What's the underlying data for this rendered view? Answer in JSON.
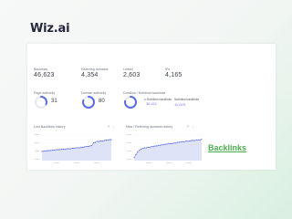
{
  "brand": "Wiz.ai",
  "stats": [
    {
      "label": "Backlinks",
      "value": "46,623"
    },
    {
      "label": "Referring domains",
      "value": "4,354"
    },
    {
      "label": "Linked",
      "value": "2,603"
    },
    {
      "label": "IPs",
      "value": "4,165"
    }
  ],
  "gauges": [
    {
      "label": "Page authority",
      "value": "31",
      "percent": 31
    },
    {
      "label": "Domain authority",
      "value": "80",
      "percent": 80
    },
    {
      "label": "Dofollow / Nofollow backlinks",
      "value": "",
      "percent": 78
    }
  ],
  "link_types": [
    {
      "label": "Dofollow backlinks",
      "value": "36,411"
    },
    {
      "label": "Nofollow backlinks",
      "value": "11,023"
    }
  ],
  "charts": [
    {
      "title": "Lost Backlinks history",
      "icons": "↗ ↓"
    },
    {
      "title": "New / Referring domains history",
      "icons": "↗ ↓"
    }
  ],
  "link_text": "Backlinks",
  "colors": {
    "accent": "#5b6ee1",
    "gauge_track": "#e6e9f2",
    "link": "#4caf50",
    "secondary": "#7b6cf0"
  },
  "chart_data": [
    {
      "type": "area",
      "title": "Lost Backlinks history",
      "y": [
        20,
        21,
        21,
        22,
        22,
        22,
        23,
        23,
        24,
        24,
        24,
        25,
        25,
        25,
        26,
        26,
        26,
        27,
        27,
        28,
        28,
        28,
        29,
        29,
        30,
        31,
        31,
        32,
        33,
        39,
        40,
        42,
        42,
        43,
        43,
        44,
        45,
        45,
        46,
        46
      ],
      "ylim": [
        0,
        60
      ]
    },
    {
      "type": "area",
      "title": "New / Referring domains history",
      "y": [
        5,
        10,
        14,
        17,
        19,
        20,
        21,
        21,
        22,
        22,
        23,
        23,
        24,
        24,
        25,
        25,
        26,
        26,
        27,
        27,
        28,
        28,
        28,
        29,
        29,
        30,
        30,
        31,
        31,
        31,
        32,
        32,
        32,
        33,
        33,
        33,
        34,
        34,
        34,
        35
      ],
      "ylim": [
        0,
        45
      ]
    }
  ]
}
